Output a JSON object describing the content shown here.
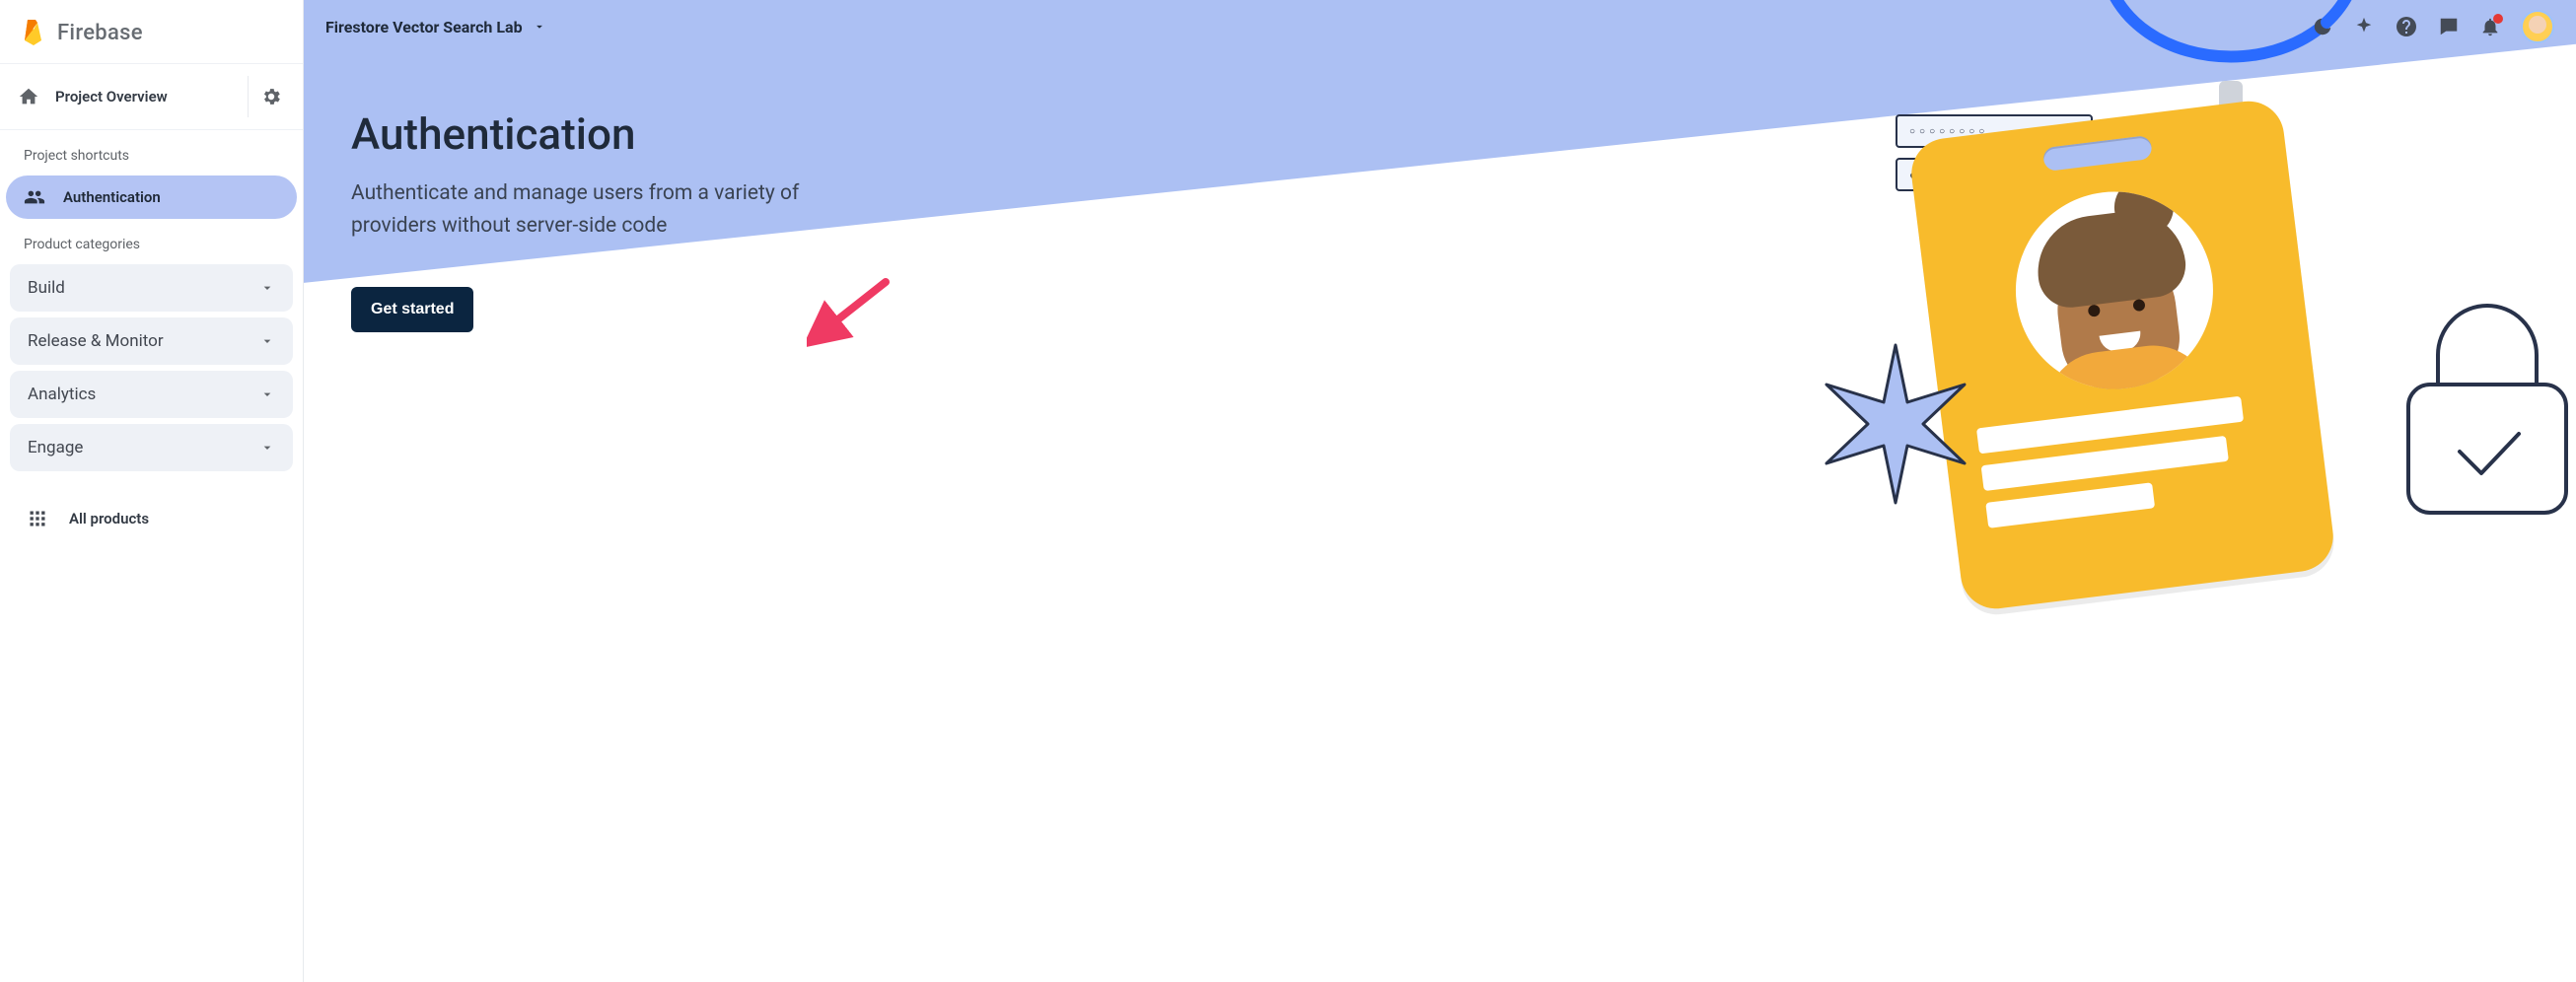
{
  "brand": {
    "name": "Firebase"
  },
  "sidebar": {
    "project_overview": "Project Overview",
    "shortcuts_label": "Project shortcuts",
    "shortcuts": [
      {
        "label": "Authentication",
        "active": true
      }
    ],
    "categories_label": "Product categories",
    "categories": [
      {
        "label": "Build"
      },
      {
        "label": "Release & Monitor"
      },
      {
        "label": "Analytics"
      },
      {
        "label": "Engage"
      }
    ],
    "all_products": "All products"
  },
  "topbar": {
    "project_name": "Firestore Vector Search Lab"
  },
  "hero": {
    "title": "Authentication",
    "subtitle": "Authenticate and manage users from a variety of providers without server-side code",
    "cta": "Get started"
  },
  "illustration": {
    "circles_text": "○○○○○○○○",
    "dots_text": "●●●●●●●●●●●●●"
  }
}
